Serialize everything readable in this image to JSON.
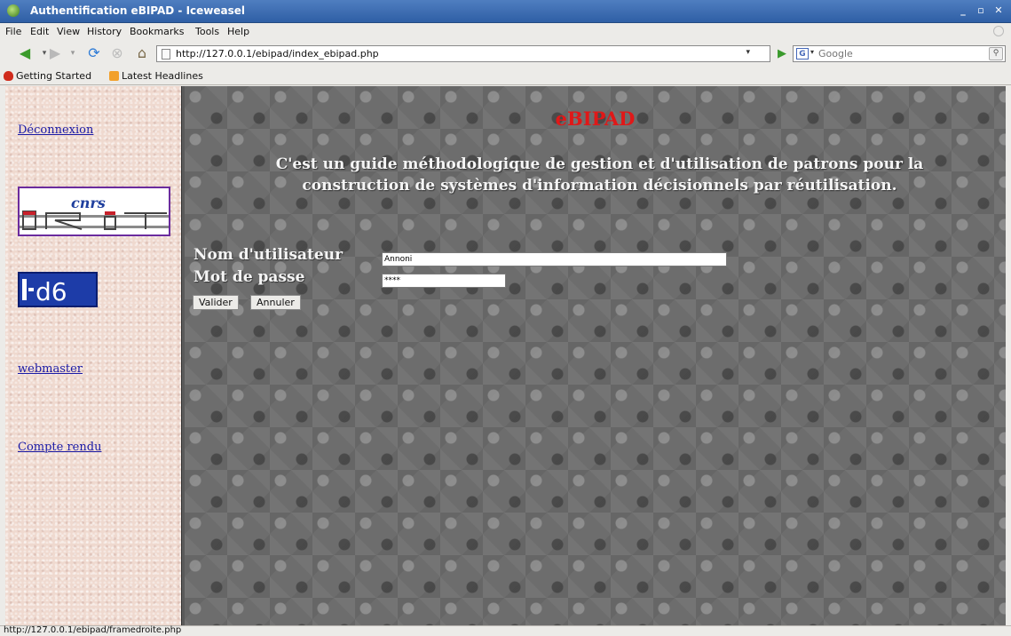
{
  "window": {
    "title": "Authentification eBIPAD - Iceweasel"
  },
  "menu": [
    "File",
    "Edit",
    "View",
    "History",
    "Bookmarks",
    "Tools",
    "Help"
  ],
  "nav": {
    "url": "http://127.0.0.1/ebipad/index_ebipad.php",
    "search_placeholder": "Google",
    "search_engine": "G"
  },
  "bookmarks": [
    "Getting Started",
    "Latest Headlines"
  ],
  "sidebar": {
    "links": [
      "Déconnexion",
      "webmaster",
      "Compte rendu"
    ],
    "logos": [
      "irit-logo",
      "id6-logo"
    ]
  },
  "main": {
    "heading": "eBIPAD",
    "description_line1": "C'est un guide méthodologique de gestion et d'utilisation de patrons pour la",
    "description_line2": "construction de systèmes d'information décisionnels par réutilisation.",
    "username_label": "Nom d'utilisateur",
    "username_value": "Annoni",
    "password_label": "Mot de passe",
    "password_value": "****",
    "submit_label": "Valider",
    "cancel_label": "Annuler"
  },
  "status": {
    "text": "http://127.0.0.1/ebipad/framedroite.php"
  },
  "colors": {
    "heading": "#e01818",
    "link": "#1a1aa6",
    "titlebar": "#3f6fb3"
  }
}
